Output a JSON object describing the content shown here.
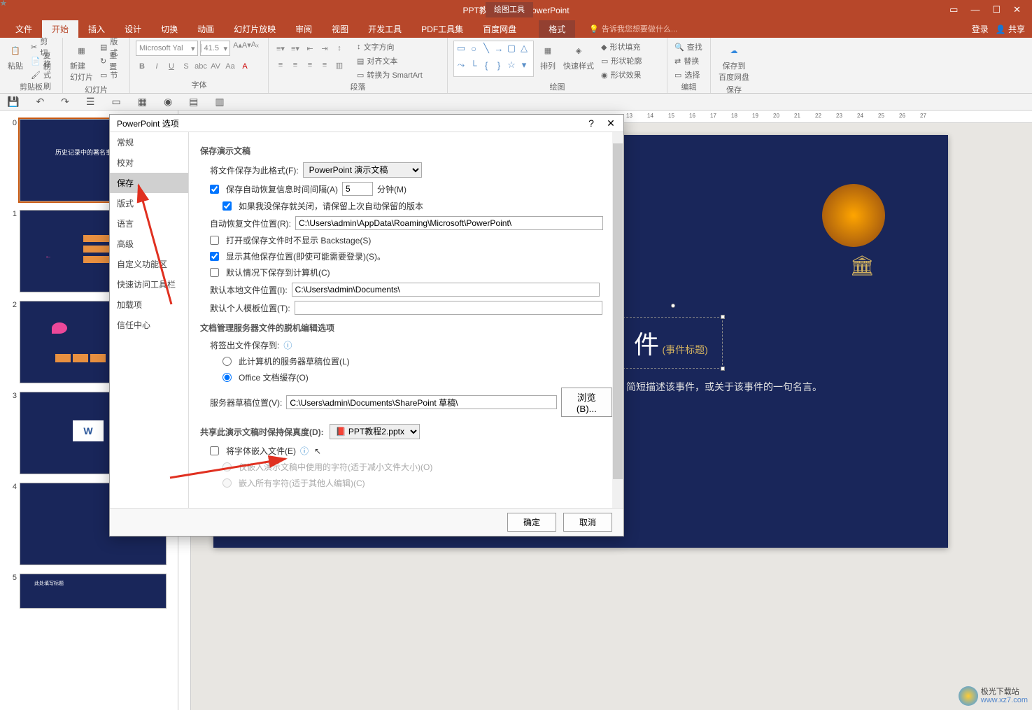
{
  "titlebar": {
    "title": "PPT教程2.pptx - PowerPoint",
    "tools_label": "绘图工具"
  },
  "tabs": {
    "file": "文件",
    "home": "开始",
    "insert": "插入",
    "design": "设计",
    "transition": "切换",
    "animation": "动画",
    "slideshow": "幻灯片放映",
    "review": "审阅",
    "view": "视图",
    "developer": "开发工具",
    "pdf": "PDF工具集",
    "baidu": "百度网盘",
    "format": "格式",
    "tell_me": "告诉我您想要做什么...",
    "login": "登录",
    "share": "共享"
  },
  "ribbon": {
    "clipboard": {
      "label": "剪贴板",
      "paste": "粘贴",
      "cut": "剪切",
      "copy": "复制",
      "format_painter": "格式刷"
    },
    "slides": {
      "label": "幻灯片",
      "new_slide": "新建\n幻灯片",
      "layout": "版式",
      "reset": "重置",
      "section": "节"
    },
    "font": {
      "label": "字体",
      "name": "Microsoft Yal",
      "size": "41.5"
    },
    "paragraph": {
      "label": "段落",
      "text_direction": "文字方向",
      "align_text": "对齐文本",
      "smartart": "转换为 SmartArt"
    },
    "drawing": {
      "label": "绘图",
      "arrange": "排列",
      "quick_styles": "快速样式",
      "fill": "形状填充",
      "outline": "形状轮廓",
      "effects": "形状效果"
    },
    "editing": {
      "label": "编辑",
      "find": "查找",
      "replace": "替换",
      "select": "选择"
    },
    "save": {
      "label": "保存",
      "save_baidu": "保存到\n百度网盘"
    }
  },
  "dialog": {
    "title": "PowerPoint 选项",
    "nav": {
      "general": "常规",
      "proofing": "校对",
      "save": "保存",
      "layout": "版式",
      "language": "语言",
      "advanced": "高级",
      "custom_ribbon": "自定义功能区",
      "qat": "快速访问工具栏",
      "addins": "加载项",
      "trust": "信任中心"
    },
    "section1_title": "保存演示文稿",
    "save_format_label": "将文件保存为此格式(F):",
    "save_format_value": "PowerPoint 演示文稿",
    "auto_recover_label": "保存自动恢复信息时间间隔(A)",
    "auto_recover_value": "5",
    "auto_recover_unit": "分钟(M)",
    "keep_last_label": "如果我没保存就关闭，请保留上次自动保留的版本",
    "auto_recover_loc_label": "自动恢复文件位置(R):",
    "auto_recover_loc_value": "C:\\Users\\admin\\AppData\\Roaming\\Microsoft\\PowerPoint\\",
    "no_backstage_label": "打开或保存文件时不显示 Backstage(S)",
    "show_other_label": "显示其他保存位置(即使可能需要登录)(S)。",
    "default_save_pc_label": "默认情况下保存到计算机(C)",
    "default_local_label": "默认本地文件位置(I):",
    "default_local_value": "C:\\Users\\admin\\Documents\\",
    "default_template_label": "默认个人模板位置(T):",
    "default_template_value": "",
    "section2_title": "文档管理服务器文件的脱机编辑选项",
    "checkout_label": "将签出文件保存到:",
    "checkout_opt1": "此计算机的服务器草稿位置(L)",
    "checkout_opt2": "Office 文档缓存(O)",
    "server_draft_label": "服务器草稿位置(V):",
    "server_draft_value": "C:\\Users\\admin\\Documents\\SharePoint 草稿\\",
    "browse": "浏览(B)...",
    "section3_title": "共享此演示文稿时保持保真度(D):",
    "fidelity_file": "PPT教程2.pptx",
    "embed_fonts_label": "将字体嵌入文件(E)",
    "embed_opt1": "仅嵌入演示文稿中使用的字符(适于减小文件大小)(O)",
    "embed_opt2": "嵌入所有字符(适于其他人编辑)(C)",
    "ok": "确定",
    "cancel": "取消"
  },
  "canvas": {
    "title_suffix": "件",
    "subtitle": "(事件标题)",
    "desc": "简短描述该事件，或关于该事件的一句名言。"
  },
  "watermark": {
    "name": "极光下载站",
    "url": "www.xz7.com"
  },
  "ruler_ticks": [
    "13",
    "14",
    "15",
    "16",
    "17",
    "18",
    "19",
    "20",
    "21",
    "22",
    "23",
    "24",
    "25",
    "26",
    "27"
  ]
}
